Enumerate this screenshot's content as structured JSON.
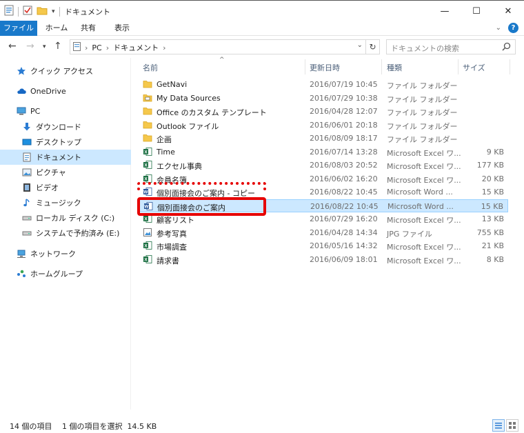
{
  "window": {
    "title": "ドキュメント",
    "controls": {
      "minimize": "—",
      "maximize": "☐",
      "close": "✕"
    }
  },
  "ribbon": {
    "tabs": [
      "ファイル",
      "ホーム",
      "共有",
      "表示"
    ]
  },
  "address": {
    "breadcrumbs": [
      "PC",
      "ドキュメント"
    ],
    "search_placeholder": "ドキュメントの検索"
  },
  "navigation": {
    "items": [
      {
        "label": "クイック アクセス",
        "icon": "star-icon",
        "selected": false
      },
      {
        "label": "OneDrive",
        "icon": "cloud-icon",
        "selected": false
      },
      {
        "label": "PC",
        "icon": "computer-icon",
        "selected": false
      },
      {
        "label": "ダウンロード",
        "icon": "download-icon",
        "selected": false
      },
      {
        "label": "デスクトップ",
        "icon": "desktop-icon",
        "selected": false
      },
      {
        "label": "ドキュメント",
        "icon": "document-icon",
        "selected": true
      },
      {
        "label": "ピクチャ",
        "icon": "picture-icon",
        "selected": false
      },
      {
        "label": "ビデオ",
        "icon": "video-icon",
        "selected": false
      },
      {
        "label": "ミュージック",
        "icon": "music-icon",
        "selected": false
      },
      {
        "label": "ローカル ディスク (C:)",
        "icon": "drive-icon",
        "selected": false
      },
      {
        "label": "システムで予約済み (E:)",
        "icon": "drive-icon",
        "selected": false
      },
      {
        "label": "ネットワーク",
        "icon": "network-icon",
        "selected": false
      },
      {
        "label": "ホームグループ",
        "icon": "homegroup-icon",
        "selected": false
      }
    ]
  },
  "columns": {
    "name": "名前",
    "modified": "更新日時",
    "type": "種類",
    "size": "サイズ"
  },
  "files": [
    {
      "name": "GetNavi",
      "modified": "2016/07/19 10:45",
      "type": "ファイル フォルダー",
      "size": "",
      "icon": "folder-icon",
      "selected": false
    },
    {
      "name": "My Data Sources",
      "modified": "2016/07/29 10:38",
      "type": "ファイル フォルダー",
      "size": "",
      "icon": "folder-datasource-icon",
      "selected": false
    },
    {
      "name": "Office のカスタム テンプレート",
      "modified": "2016/04/28 12:07",
      "type": "ファイル フォルダー",
      "size": "",
      "icon": "folder-icon",
      "selected": false
    },
    {
      "name": "Outlook ファイル",
      "modified": "2016/06/01 20:18",
      "type": "ファイル フォルダー",
      "size": "",
      "icon": "folder-icon",
      "selected": false
    },
    {
      "name": "企画",
      "modified": "2016/08/09 18:17",
      "type": "ファイル フォルダー",
      "size": "",
      "icon": "folder-icon",
      "selected": false
    },
    {
      "name": "Time",
      "modified": "2016/07/14 13:28",
      "type": "Microsoft Excel ワ...",
      "size": "9 KB",
      "icon": "excel-icon",
      "selected": false
    },
    {
      "name": "エクセル事典",
      "modified": "2016/08/03 20:52",
      "type": "Microsoft Excel ワ...",
      "size": "177 KB",
      "icon": "excel-icon",
      "selected": false
    },
    {
      "name": "会員名簿",
      "modified": "2016/06/02 16:20",
      "type": "Microsoft Excel ワ...",
      "size": "20 KB",
      "icon": "excel-icon",
      "selected": false
    },
    {
      "name": "個別面接会のご案内 - コピー",
      "modified": "2016/08/22 10:45",
      "type": "Microsoft Word ...",
      "size": "15 KB",
      "icon": "word-icon",
      "selected": false
    },
    {
      "name": "個別面接会のご案内",
      "modified": "2016/08/22 10:45",
      "type": "Microsoft Word ...",
      "size": "15 KB",
      "icon": "word-icon",
      "selected": true
    },
    {
      "name": "顧客リスト",
      "modified": "2016/07/29 16:20",
      "type": "Microsoft Excel ワ...",
      "size": "13 KB",
      "icon": "excel-icon",
      "selected": false
    },
    {
      "name": "参考写真",
      "modified": "2016/04/28 14:34",
      "type": "JPG ファイル",
      "size": "755 KB",
      "icon": "image-icon",
      "selected": false
    },
    {
      "name": "市場調査",
      "modified": "2016/05/16 14:32",
      "type": "Microsoft Excel ワ...",
      "size": "21 KB",
      "icon": "excel-icon",
      "selected": false
    },
    {
      "name": "請求書",
      "modified": "2016/06/09 18:01",
      "type": "Microsoft Excel ワ...",
      "size": "8 KB",
      "icon": "excel-icon",
      "selected": false
    }
  ],
  "status": {
    "item_count": "14 個の項目",
    "selection": "1 個の項目を選択  14.5 KB"
  },
  "colors": {
    "accent": "#1979ca",
    "selection": "#cce8ff",
    "annotation_red": "#e60000",
    "folder": "#f5c84c",
    "excel": "#1e7145",
    "word": "#2b579a"
  }
}
